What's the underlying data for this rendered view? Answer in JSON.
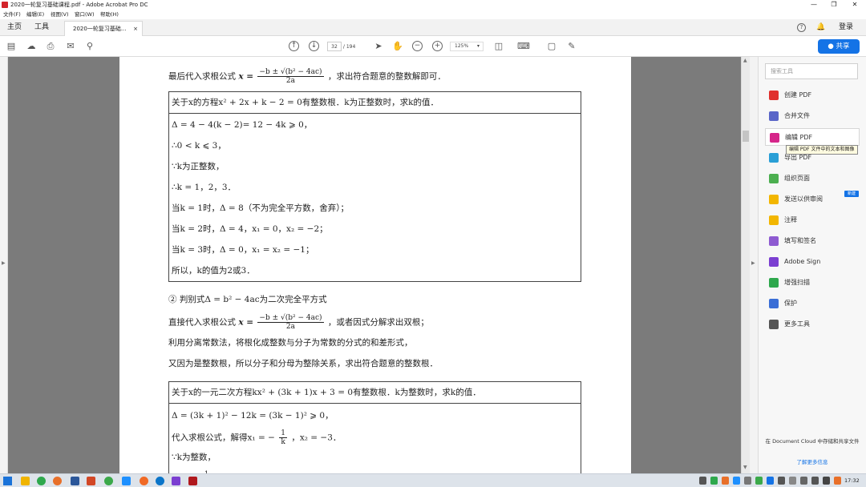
{
  "window": {
    "title": "2020一轮复习基础课程.pdf - Adobe Acrobat Pro DC",
    "controls": {
      "minimize": "—",
      "restore": "❐",
      "close": "✕"
    }
  },
  "menu": [
    "文件(F)",
    "编辑(E)",
    "视图(V)",
    "窗口(W)",
    "帮助(H)"
  ],
  "nav": {
    "home": "主页",
    "tools": "工具",
    "doc_tab": "2020一轮复习基础...",
    "doc_tab_close": "×",
    "login": "登录"
  },
  "toolbar": {
    "page_current": "32",
    "page_total": "/ 194",
    "zoom": "125%",
    "zoom_caret": "▾",
    "share": "共享"
  },
  "pdf": {
    "l1_a": "最后代入求根公式",
    "l1_x": "x =",
    "l1_num": "−b ± √(b² − 4ac)",
    "l1_den": "2a",
    "l1_b": "，求出符合题意的整数解即可．",
    "box1": {
      "header": "关于x的方程x² + 2x + k − 2 = 0有整数根．k为正整数时，求k的值．",
      "lines": [
        "Δ = 4 − 4(k − 2)= 12 − 4k ⩾ 0，",
        "∴0 < k ⩽ 3，",
        "∵k为正整数，",
        "∴k = 1，2，3．",
        "当k = 1时，Δ = 8（不为完全平方数，舍弃）；",
        "当k = 2时，Δ = 4，x₁ = 0，x₂ = −2；",
        "当k = 3时，Δ = 0，x₁ = x₂ = −1；",
        "所以，k的值为2或3．"
      ]
    },
    "l2": "② 判别式Δ = b² − 4ac为二次完全平方式",
    "l3_a": "直接代入求根公式",
    "l3_x": "x =",
    "l3_num": "−b ± √(b² − 4ac)",
    "l3_den": "2a",
    "l3_b": "，或者因式分解求出双根；",
    "l4": "利用分离常数法，将根化成整数与分子为常数的分式的和差形式，",
    "l5": "又因为是整数根，所以分子和分母为整除关系，求出符合题意的整数根．",
    "box2": {
      "header": "关于x的一元二次方程kx² + (3k + 1)x + 3 = 0有整数根．k为整数时，求k的值．",
      "line1": "Δ = (3k + 1)² − 12k = (3k − 1)² ⩾ 0，",
      "line2_a": "代入求根公式，解得x₁ = −",
      "line2_num": "1",
      "line2_den": "k",
      "line2_b": "，x₂ = −3．",
      "line3": "∵k为整数，",
      "line4": "1"
    }
  },
  "tools_panel": {
    "search_placeholder": "搜索工具",
    "items": [
      {
        "label": "创建 PDF",
        "color": "#e0312e",
        "icon": "create-pdf-icon"
      },
      {
        "label": "合并文件",
        "color": "#5a66c8",
        "icon": "combine-files-icon"
      },
      {
        "label": "编辑 PDF",
        "color": "#d6268a",
        "icon": "edit-pdf-icon"
      },
      {
        "label": "导出 PDF",
        "color": "#2a9fd6",
        "icon": "export-pdf-icon"
      },
      {
        "label": "组织页面",
        "color": "#4caf50",
        "icon": "organize-pages-icon"
      },
      {
        "label": "发送以供审阅",
        "color": "#f2b600",
        "icon": "send-review-icon"
      },
      {
        "label": "注释",
        "color": "#f2b600",
        "icon": "comment-icon"
      },
      {
        "label": "填写和签名",
        "color": "#8e5bd1",
        "icon": "fill-sign-icon"
      },
      {
        "label": "Adobe Sign",
        "color": "#7b3fd1",
        "icon": "adobe-sign-icon"
      },
      {
        "label": "增强扫描",
        "color": "#2ea84d",
        "icon": "enhance-scan-icon"
      },
      {
        "label": "保护",
        "color": "#3b6fd6",
        "icon": "protect-icon"
      },
      {
        "label": "更多工具",
        "color": "#555555",
        "icon": "more-tools-icon"
      }
    ],
    "tooltip": "编辑 PDF 文件中的文本和图像",
    "new_badge": "新建",
    "cloud_text": "在 Document Cloud 中存储和共享文件",
    "cloud_link": "了解更多信息"
  },
  "taskbar": {
    "clock": "17:32"
  }
}
